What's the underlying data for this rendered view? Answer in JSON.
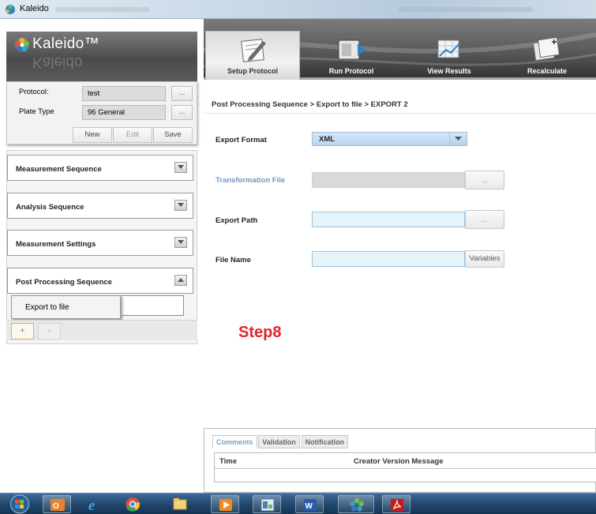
{
  "window": {
    "title": "Kaleido"
  },
  "logo": {
    "text": "Kaleido™",
    "reflection": "Kaleido"
  },
  "protocol": {
    "protocol_label": "Protocol:",
    "protocol_value": "test",
    "plate_type_label": "Plate Type",
    "plate_type_value": "96 General",
    "browse_label": "...",
    "new_label": "New",
    "edit_label": "Edit",
    "save_label": "Save"
  },
  "sequences": {
    "items": [
      {
        "label": "Measurement Sequence",
        "state": "collapsed"
      },
      {
        "label": "Analysis Sequence",
        "state": "collapsed"
      },
      {
        "label": "Measurement Settings",
        "state": "collapsed"
      },
      {
        "label": "Post Processing Sequence",
        "state": "expanded"
      }
    ],
    "context_menu_item": "Export to file",
    "add_label": "+",
    "remove_label": "-"
  },
  "nav": {
    "tabs": [
      {
        "label": "Setup Protocol",
        "icon": "edit-document-icon",
        "active": true
      },
      {
        "label": "Run Protocol",
        "icon": "plate-reader-icon",
        "active": false
      },
      {
        "label": "View Results",
        "icon": "results-chart-icon",
        "active": false
      },
      {
        "label": "Recalculate",
        "icon": "recalculate-icon",
        "active": false
      }
    ]
  },
  "form": {
    "breadcrumb": "Post Processing Sequence > Export to file > EXPORT 2",
    "export_format_label": "Export Format",
    "export_format_value": "XML",
    "transformation_file_label": "Transformation File",
    "export_path_label": "Export Path",
    "file_name_label": "File Name",
    "browse_label": "...",
    "variables_label": "Variables"
  },
  "annotation": {
    "text": "Step8",
    "color": "#e6232a"
  },
  "bottom_panel": {
    "tabs": [
      {
        "label": "Comments",
        "active": true
      },
      {
        "label": "Validation",
        "active": false
      },
      {
        "label": "Notification",
        "active": false
      }
    ],
    "columns": {
      "time": "Time",
      "creator_version_message": "Creator Version Message"
    }
  },
  "taskbar": {
    "items": [
      "start-orb-icon",
      "outlook-icon",
      "internet-explorer-icon",
      "chrome-icon",
      "file-explorer-icon",
      "media-player-icon",
      "app-window-icon",
      "word-icon",
      "kaleido-icon",
      "acrobat-icon"
    ]
  },
  "colors": {
    "accent": "#7aa2c9",
    "input_bg": "#e6f3fb",
    "step_red": "#e6232a"
  }
}
